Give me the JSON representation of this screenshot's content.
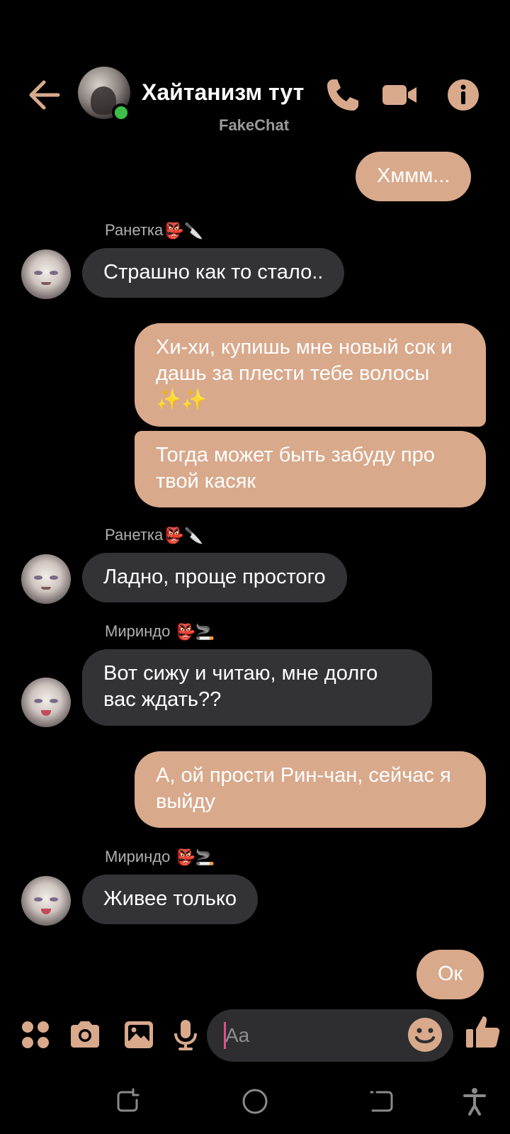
{
  "header": {
    "title": "Хайтанизм тут",
    "subtitle": "FakeChat"
  },
  "colors": {
    "accent": "#d9a98c",
    "incoming_bubble": "#333336",
    "online": "#3bbf4a",
    "background": "#000000"
  },
  "messages": [
    {
      "type": "out",
      "text": "Хммм..."
    },
    {
      "type": "sender",
      "name": "Ранетка",
      "emoji": "👺🔪"
    },
    {
      "type": "in",
      "text": "Страшно как то стало.."
    },
    {
      "type": "out",
      "text": "Хи-хи, купишь мне новый сок и дашь за плести тебе волосы ✨✨"
    },
    {
      "type": "out",
      "text": "Тогда может быть забуду про твой касяк"
    },
    {
      "type": "sender",
      "name": "Ранетка",
      "emoji": "👺🔪"
    },
    {
      "type": "in",
      "text": "Ладно, проще простого"
    },
    {
      "type": "sender",
      "name": "Мириндо ",
      "emoji": "👺🚬"
    },
    {
      "type": "in",
      "text": "Вот сижу и читаю, мне долго вас ждать??"
    },
    {
      "type": "out",
      "text": "А, ой  прости Рин-чан, сейчас я выйду"
    },
    {
      "type": "sender",
      "name": "Мириндо ",
      "emoji": "👺🚬"
    },
    {
      "type": "in",
      "text": "Живее только"
    },
    {
      "type": "out",
      "text": "Ок"
    }
  ],
  "composer": {
    "placeholder": "Aa",
    "icons": [
      "apps-icon",
      "camera-icon",
      "gallery-icon",
      "mic-icon",
      "emoji-icon",
      "thumbs-up-icon"
    ]
  },
  "navbar": {
    "icons": [
      "recents-icon",
      "home-icon",
      "back-icon",
      "accessibility-icon"
    ]
  }
}
